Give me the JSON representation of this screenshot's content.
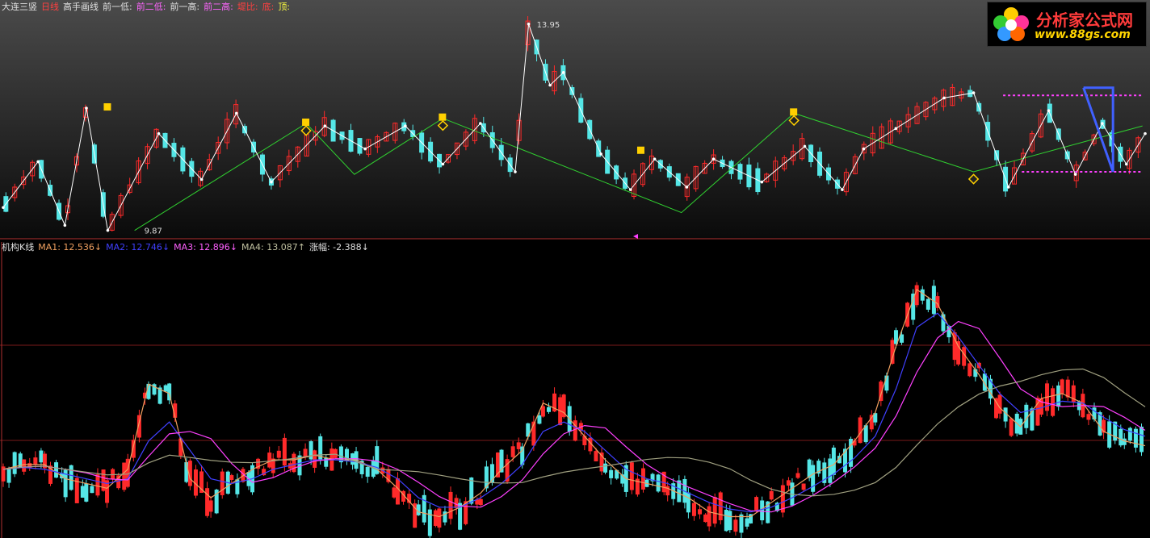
{
  "upper_panel": {
    "header": [
      {
        "text": "大连三竖",
        "color": "#e0e0e0"
      },
      {
        "text": "日线",
        "color": "#ff4040"
      },
      {
        "text": "高手画线",
        "color": "#e0e0e0"
      },
      {
        "text": "前一低:",
        "color": "#e0e0e0"
      },
      {
        "text": "前二低:",
        "color": "#ff66ff"
      },
      {
        "text": "前一高:",
        "color": "#e0e0e0"
      },
      {
        "text": "前二高:",
        "color": "#ff66ff"
      },
      {
        "text": "堤比:",
        "color": "#ff4040"
      },
      {
        "text": "底:",
        "color": "#ff4040"
      },
      {
        "text": "顶:",
        "color": "#ffff40"
      }
    ],
    "high_label": "13.95",
    "low_label": "9.87"
  },
  "lower_panel": {
    "header": [
      {
        "text": "机构K线",
        "color": "#e0e0e0"
      },
      {
        "text": "MA1: 12.536↓",
        "color": "#f0a060"
      },
      {
        "text": "MA2: 12.746↓",
        "color": "#4040ff"
      },
      {
        "text": "MA3: 12.896↓",
        "color": "#ff60ff"
      },
      {
        "text": "MA4: 13.087↑",
        "color": "#c0c0a0"
      },
      {
        "text": "涨幅: -2.388↓",
        "color": "#e0e0e0"
      }
    ]
  },
  "logo": {
    "title": "分析家公式网",
    "url": "www.88gs.com"
  },
  "colors": {
    "up": "#ff2a2a",
    "down": "#55e6e6",
    "zigzag_white": "#ffffff",
    "zigzag_green": "#30d030",
    "channel_magenta": "#ff40ff",
    "ma1": "#f0a060",
    "ma2": "#4040ff",
    "ma3": "#ff40ff",
    "ma4": "#a0a080"
  },
  "chart_data": [
    {
      "type": "line",
      "name": "upper-price-zigzag",
      "white_zigzag": {
        "x": [
          0,
          13,
          23,
          31,
          39,
          58,
          74,
          87,
          100,
          120,
          135,
          150,
          164,
          178,
          191,
          196,
          204,
          209,
          223,
          234,
          243,
          255,
          265,
          283,
          299,
          313,
          321,
          333,
          351,
          362,
          375,
          390,
          400,
          410,
          419,
          426
        ],
        "y": [
          10.35,
          11.25,
          10.0,
          12.3,
          9.9,
          11.8,
          10.9,
          12.2,
          10.85,
          11.95,
          11.5,
          11.95,
          11.2,
          12.0,
          11.05,
          13.95,
          12.75,
          13.0,
          11.4,
          10.7,
          11.3,
          10.75,
          11.3,
          10.85,
          11.55,
          10.7,
          11.5,
          11.9,
          12.5,
          12.6,
          10.75,
          12.25,
          11.0,
          12.0,
          11.2,
          11.8
        ],
        "xlim": [
          0,
          426
        ],
        "ylim": [
          9.8,
          14.2
        ]
      },
      "green_zigzag": {
        "x": [
          49,
          113,
          131,
          164,
          253,
          295,
          362,
          425
        ],
        "y": [
          9.9,
          12.0,
          11.0,
          12.1,
          10.25,
          12.2,
          11.05,
          11.95
        ],
        "xlim": [
          0,
          426
        ],
        "ylim": [
          9.8,
          14.2
        ]
      }
    },
    {
      "type": "line",
      "name": "lower-institutional-k",
      "ma1": [
        9.7,
        9.75,
        9.75,
        9.6,
        9.55,
        9.5,
        9.7,
        10.6,
        10.5,
        9.6,
        9.4,
        9.55,
        9.7,
        9.8,
        9.8,
        9.85,
        9.8,
        9.8,
        9.7,
        9.5,
        9.25,
        9.2,
        9.3,
        9.45,
        9.7,
        9.9,
        10.4,
        10.3,
        10.05,
        9.8,
        9.6,
        9.55,
        9.5,
        9.4,
        9.25,
        9.2,
        9.2,
        9.35,
        9.5,
        9.65,
        9.75,
        10.0,
        10.3,
        11.0,
        11.6,
        11.45,
        11.0,
        10.7,
        10.35,
        10.15,
        10.45,
        10.5,
        10.4,
        10.1,
        10.0,
        9.95
      ],
      "ma2": [
        9.7,
        9.72,
        9.7,
        9.65,
        9.6,
        9.55,
        9.6,
        10.0,
        10.2,
        9.9,
        9.6,
        9.55,
        9.6,
        9.7,
        9.75,
        9.8,
        9.8,
        9.78,
        9.72,
        9.6,
        9.4,
        9.3,
        9.3,
        9.4,
        9.55,
        9.75,
        10.1,
        10.2,
        10.1,
        9.9,
        9.7,
        9.6,
        9.55,
        9.45,
        9.35,
        9.28,
        9.25,
        9.3,
        9.4,
        9.52,
        9.65,
        9.82,
        10.05,
        10.55,
        11.2,
        11.35,
        11.1,
        10.8,
        10.5,
        10.3,
        10.35,
        10.42,
        10.4,
        10.25,
        10.12,
        10.05
      ],
      "x": [
        0,
        8,
        16,
        24,
        32,
        40,
        48,
        56,
        64,
        72,
        80,
        88,
        96,
        104,
        112,
        120,
        128,
        136,
        144,
        152,
        160,
        168,
        176,
        184,
        192,
        200,
        208,
        216,
        224,
        232,
        240,
        248,
        256,
        264,
        272,
        280,
        288,
        296,
        304,
        312,
        320,
        328,
        336,
        344,
        352,
        360,
        368,
        376,
        384,
        392,
        400,
        408,
        416,
        424,
        432,
        440
      ],
      "ylim": [
        9.0,
        12.0
      ]
    }
  ]
}
